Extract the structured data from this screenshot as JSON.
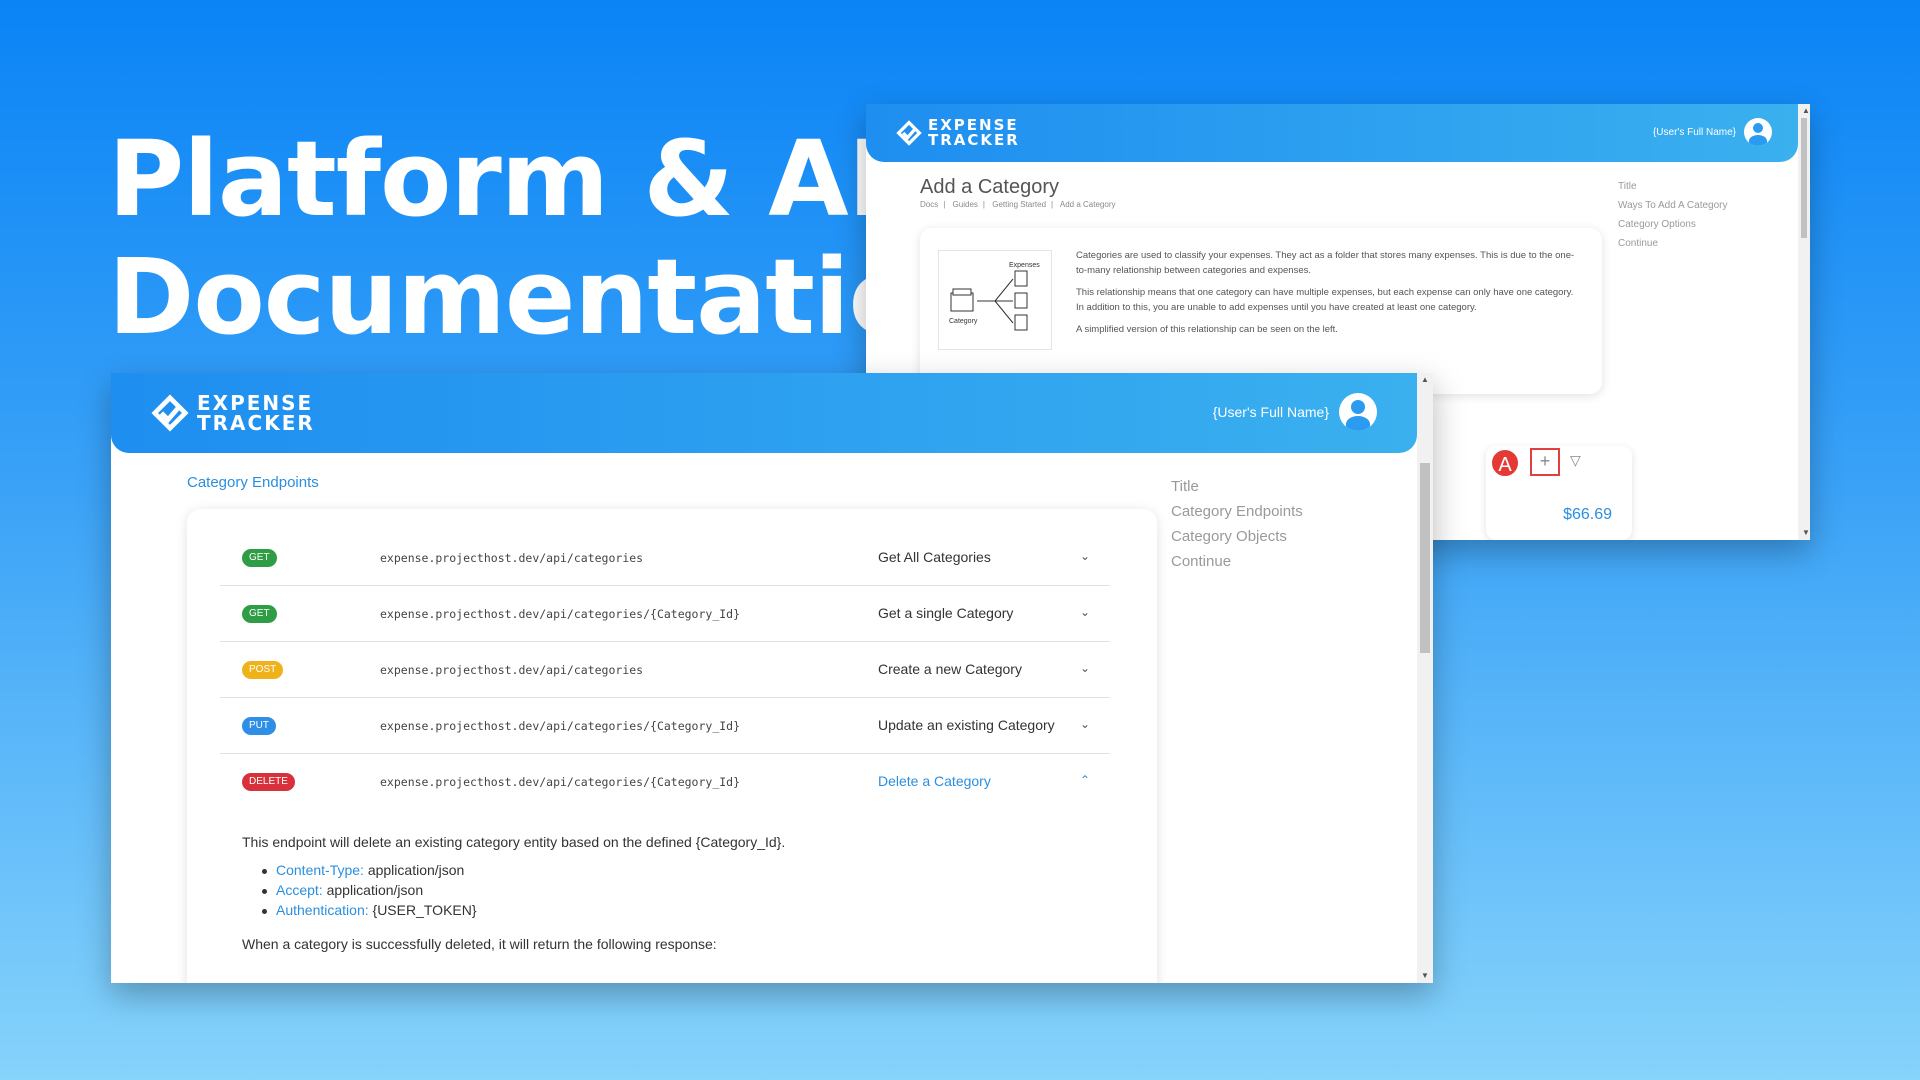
{
  "hero": {
    "line1": "Platform & API",
    "line2": "Documentation"
  },
  "brand": {
    "line1": "EXPENSE",
    "line2": "TRACKER"
  },
  "user": {
    "name": "{User's Full Name}"
  },
  "back_window": {
    "page_title": "Add a Category",
    "breadcrumbs": [
      "Docs",
      "Guides",
      "Getting Started",
      "Add a Category"
    ],
    "diagram": {
      "top_label": "Expenses",
      "bottom_label": "Category"
    },
    "paragraphs": [
      "Categories are used to classify your expenses. They act as a folder that stores many expenses. This is due to the one-to-many relationship between categories and expenses.",
      "This relationship means that one category can have multiple expenses, but each expense can only have one category. In addition to this, you are unable to add expenses until you have created at least one category.",
      "A simplified version of this relationship can be seen on the left."
    ],
    "toc": [
      "Title",
      "Ways To Add A Category",
      "Category Options",
      "Continue"
    ],
    "badge": "A",
    "add_symbol": "+",
    "amount": "$66.69"
  },
  "front_window": {
    "section_title": "Category Endpoints",
    "endpoints": [
      {
        "method": "GET",
        "url": "expense.projecthost.dev/api/categories",
        "label": "Get All Categories",
        "expanded": false
      },
      {
        "method": "GET",
        "url": "expense.projecthost.dev/api/categories/{Category_Id}",
        "label": "Get a single Category",
        "expanded": false
      },
      {
        "method": "POST",
        "url": "expense.projecthost.dev/api/categories",
        "label": "Create a new Category",
        "expanded": false
      },
      {
        "method": "PUT",
        "url": "expense.projecthost.dev/api/categories/{Category_Id}",
        "label": "Update an existing Category",
        "expanded": false
      },
      {
        "method": "DELETE",
        "url": "expense.projecthost.dev/api/categories/{Category_Id}",
        "label": "Delete a Category",
        "expanded": true
      }
    ],
    "detail": {
      "intro": "This endpoint will delete an existing category entity based on the defined {Category_Id}.",
      "headers": [
        {
          "key": "Content-Type:",
          "value": "application/json"
        },
        {
          "key": "Accept:",
          "value": "application/json"
        },
        {
          "key": "Authentication:",
          "value": "{USER_TOKEN}"
        }
      ],
      "outro": "When a category is successfully deleted, it will return the following response:"
    },
    "toc": [
      "Title",
      "Category Endpoints",
      "Category Objects",
      "Continue"
    ]
  },
  "colors": {
    "accent": "#2a8fe0",
    "get": "#2e9d45",
    "post": "#f0b21b",
    "put": "#2f8ee6",
    "delete": "#d8313b"
  }
}
